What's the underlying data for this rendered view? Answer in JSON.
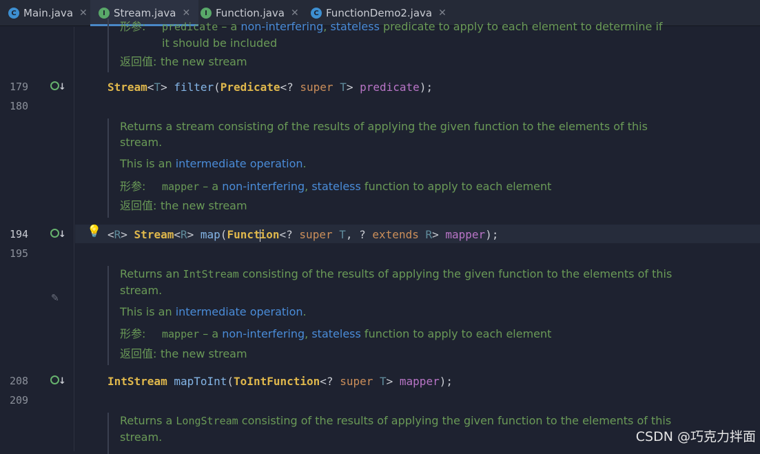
{
  "tabs": [
    {
      "label": "Main.java",
      "icon": "class-c-icon",
      "icon_glyph": "C"
    },
    {
      "label": "Stream.java",
      "icon": "interface-i-icon",
      "icon_glyph": "I"
    },
    {
      "label": "Function.java",
      "icon": "interface-i-icon",
      "icon_glyph": "I"
    },
    {
      "label": "FunctionDemo2.java",
      "icon": "class-c-icon",
      "icon_glyph": "C"
    }
  ],
  "tab_close_glyph": "✕",
  "gutter": {
    "lines": [
      "179",
      "180",
      "194",
      "195",
      "208",
      "209"
    ]
  },
  "docs": {
    "top": {
      "param_label": "形参:",
      "param_line1_code": "predicate",
      "param_line1_text": " – a ",
      "param_line1_link1": "non-interfering",
      "param_line1_sep": ", ",
      "param_line1_link2": "stateless",
      "param_line1_rest": " predicate to apply to each element to determine if",
      "param_line2": "it should be included",
      "return_label": "返回值:",
      "return_text": "the new stream"
    },
    "map": {
      "desc_line1": "Returns a stream consisting of the results of applying the given function to the elements of this",
      "desc_line2": "stream.",
      "intermediate_pre": "This is an ",
      "intermediate_link": "intermediate operation",
      "intermediate_post": ".",
      "param_label": "形参:",
      "param_code": "mapper",
      "param_mid": " – a ",
      "param_link1": "non-interfering",
      "param_sep": ", ",
      "param_link2": "stateless",
      "param_rest": " function to apply to each element",
      "return_label": "返回值:",
      "return_text": "the new stream"
    },
    "mapToInt": {
      "desc_pre": "Returns an ",
      "desc_code": "IntStream",
      "desc_post": " consisting of the results of applying the given function to the elements of this",
      "desc_line2": "stream.",
      "intermediate_pre": "This is an ",
      "intermediate_link": "intermediate operation",
      "intermediate_post": ".",
      "param_label": "形参:",
      "param_code": "mapper",
      "param_mid": " – a ",
      "param_link1": "non-interfering",
      "param_sep": ", ",
      "param_link2": "stateless",
      "param_rest": " function to apply to each element",
      "return_label": "返回值:",
      "return_text": "the new stream"
    },
    "mapToLong": {
      "desc_pre": "Returns a ",
      "desc_code": "LongStream",
      "desc_post": " consisting of the results of applying the given function to the elements of this",
      "desc_line2": "stream."
    }
  },
  "code": {
    "filter": {
      "t1": "Stream",
      "t2": "<",
      "t3": "T",
      "t4": "> ",
      "t5": "filter",
      "t6": "(",
      "t7": "Predicate",
      "t8": "<? ",
      "t9": "super",
      "t10": " ",
      "t11": "T",
      "t12": "> ",
      "t13": "predicate",
      "t14": ");"
    },
    "map": {
      "t1": "<",
      "t2": "R",
      "t3": "> ",
      "t4": "Stream",
      "t5": "<",
      "t6": "R",
      "t7": "> ",
      "t8": "map",
      "t9": "(",
      "t10a": "Funct",
      "t10b": "ion",
      "t11": "<? ",
      "t12": "super",
      "t13": " ",
      "t14": "T",
      "t15": ", ? ",
      "t16": "extends",
      "t17": " ",
      "t18": "R",
      "t19": "> ",
      "t20": "mapper",
      "t21": ");"
    },
    "mapToInt": {
      "t1": "IntStream",
      "t2": " ",
      "t3": "mapToInt",
      "t4": "(",
      "t5": "ToIntFunction",
      "t6": "<? ",
      "t7": "super",
      "t8": " ",
      "t9": "T",
      "t10": "> ",
      "t11": "mapper",
      "t12": ");"
    }
  },
  "watermark": "CSDN @巧克力拌面",
  "colors": {
    "background": "#1e2230",
    "doc_text": "#6a9a57",
    "link": "#4a8cd8",
    "type": "#e0b84c",
    "keyword": "#cc8f5a",
    "param": "#b975c7",
    "active_tab_underline": "#4a88c7"
  }
}
